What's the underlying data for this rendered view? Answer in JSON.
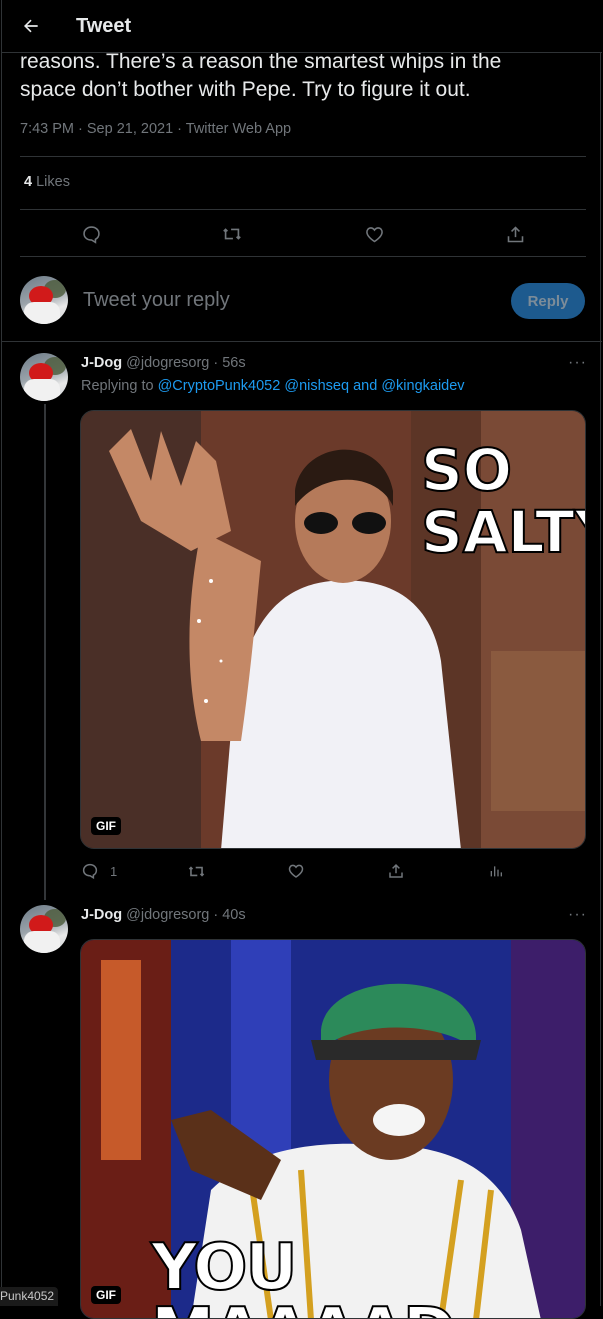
{
  "header": {
    "title": "Tweet"
  },
  "tweet": {
    "text_line1": "reasons. There’s a reason the smartest whips in the",
    "text_line2": "space don’t bother with Pepe. Try to figure it out.",
    "meta": "7:43 PM · Sep 21, 2021 · Twitter Web App",
    "likes_count": "4",
    "likes_label": "Likes"
  },
  "composer": {
    "placeholder": "Tweet your reply",
    "button_label": "Reply"
  },
  "replies": [
    {
      "name": "J-Dog",
      "handle_time": "@jdogresorg · 56s",
      "replying_prefix": "Replying to",
      "mentions": [
        "@CryptoPunk4052",
        "@nishseq",
        "and",
        "@kingkaidev"
      ],
      "gif_badge": "GIF",
      "meme_line1": "SO",
      "meme_line2": "SALTY",
      "reply_count": "1"
    },
    {
      "name": "J-Dog",
      "handle_time": "@jdogresorg · 40s",
      "gif_badge": "GIF",
      "meme_text": "YOU MAAAAD"
    }
  ],
  "taskbar_stub": "Punk4052",
  "colors": {
    "background": "#000000",
    "accent": "#1d9bf0",
    "muted": "#71767b",
    "border": "#2f3336"
  }
}
